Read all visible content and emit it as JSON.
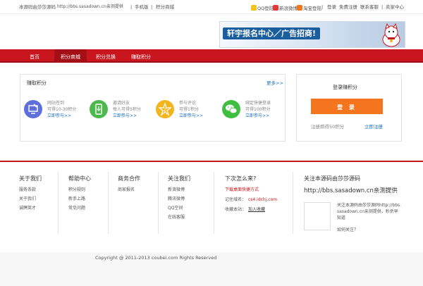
{
  "topbar": {
    "source_note": "本源码由莎莎源码",
    "source_url": "http://bbs.sasadown.cn亲测提供",
    "mobile": "手机版",
    "mall": "积分商城",
    "qq_login": "QQ登陆",
    "weibo_login": "新浪微博",
    "taobao_login": "淘宝登陆",
    "login": "登录",
    "register": "免费注册",
    "contact": "联系客服",
    "seller": "卖家中心"
  },
  "banner": {
    "text": "轩宇报名中心／广告招商!"
  },
  "nav": {
    "items": [
      {
        "label": "首页"
      },
      {
        "label": "积分商城"
      },
      {
        "label": "积分兑换"
      },
      {
        "label": "赚取积分"
      }
    ]
  },
  "earn": {
    "title": "赚取积分",
    "more": "更多>>",
    "features": [
      {
        "line1": "网站签到",
        "line2": "可得10-30积分",
        "link": "立即参与>>",
        "color": "#5e6fdc"
      },
      {
        "line1": "邀请好友",
        "line2": "每人可得5积分",
        "link": "立即参与>>",
        "color": "#4db84d"
      },
      {
        "line1": "参与评论",
        "line2": "可得1积分",
        "link": "立即参与>>",
        "color": "#f2b51c"
      },
      {
        "line1": "绑定快捷登录",
        "line2": "可得100积分",
        "link": "立即参与>>",
        "color": "#3fbf3f"
      }
    ]
  },
  "login_box": {
    "title": "登录赚积分",
    "button": "登  录",
    "register_note": "注册即得50积分",
    "register_link": "立即注册"
  },
  "footer": {
    "columns": [
      {
        "title": "关于我们",
        "links": [
          "服务条款",
          "关于我们",
          "诚聘英才"
        ]
      },
      {
        "title": "帮助中心",
        "links": [
          "积分规则",
          "新手上路",
          "常见问题"
        ]
      },
      {
        "title": "商务合作",
        "links": [
          "商家报名"
        ]
      },
      {
        "title": "关注我们",
        "links": [
          "新浪微博",
          "腾讯微博",
          "QQ空间",
          "在线客服"
        ]
      }
    ],
    "next_visit": {
      "title": "下次怎么来?",
      "download": "下载桌面快捷方式",
      "domain_label": "记住域名：",
      "domain": "cs4.idchj.com",
      "favorite_label": "收藏本站：",
      "favorite_link": "加入收藏"
    },
    "follow": {
      "title": "关注本源码由莎莎源码",
      "url": "http://bbs.sasadown.cn亲测提供",
      "qr_text": "关注本源码由莎莎源码http://bbs.sasadown.cn亲测提供，秒杀早知道",
      "how": "如何关注？"
    },
    "copyright": "Copyright @ 2011-2013 coubei.com Rights Reserved"
  },
  "colors": {
    "brand_red": "#c9161e",
    "login_orange": "#f5751f",
    "link_blue": "#1a6fc4"
  }
}
